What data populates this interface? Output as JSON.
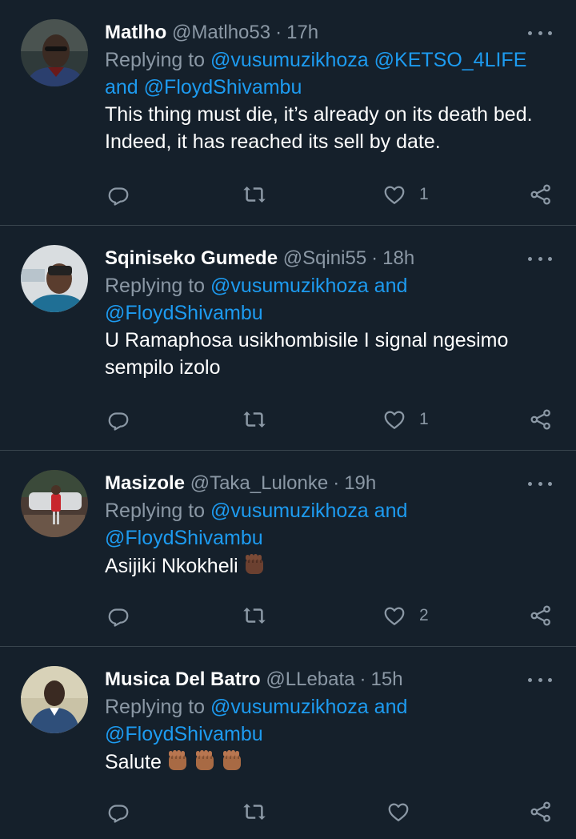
{
  "tweets": [
    {
      "name": "Matlho",
      "handle": "@Matlho53",
      "time": "17h",
      "reply_prefix": "Replying to ",
      "reply_line1_mentions": "@vusumuzikhoza @KETSO_4LIFE",
      "reply_line2_connector": "and ",
      "reply_line2_mentions": "@FloydShivambu",
      "body_line1": "This thing must die, it’s already on its death bed.",
      "body_line2": "Indeed, it has reached its sell by date.",
      "like_count": "1"
    },
    {
      "name": "Sqiniseko Gumede",
      "handle": "@Sqini55",
      "time": "18h",
      "reply_prefix": "Replying to ",
      "reply_line1_mentions": "@vusumuzikhoza",
      "reply_line1_connector": " and",
      "reply_line2_mentions": "@FloydShivambu",
      "body_line1": "U Ramaphosa usikhombisile I signal ngesimo",
      "body_line2": "sempilo izolo",
      "like_count": "1"
    },
    {
      "name": "Masizole",
      "handle": "@Taka_Lulonke",
      "time": "19h",
      "reply_prefix": "Replying to ",
      "reply_line1_mentions": "@vusumuzikhoza",
      "reply_line1_connector": " and",
      "reply_line2_mentions": "@FloydShivambu",
      "body_line1": "Asijiki Nkokheli",
      "like_count": "2"
    },
    {
      "name": "Musica Del Batro",
      "handle": "@LLebata",
      "time": "15h",
      "reply_prefix": "Replying to ",
      "reply_line1_mentions": "@vusumuzikhoza",
      "reply_line1_connector": " and",
      "reply_line2_mentions": "@FloydShivambu",
      "body_line1": "Salute",
      "like_count": ""
    }
  ],
  "separator": "·",
  "icons": [
    "reply-icon",
    "retweet-icon",
    "like-icon",
    "share-icon",
    "more-icon",
    "raised-fist-emoji"
  ],
  "colors": {
    "background": "#15202b",
    "divider": "#38444d",
    "secondary_text": "#8b98a5",
    "mention": "#1d9bf0",
    "primary_text": "#ffffff"
  }
}
